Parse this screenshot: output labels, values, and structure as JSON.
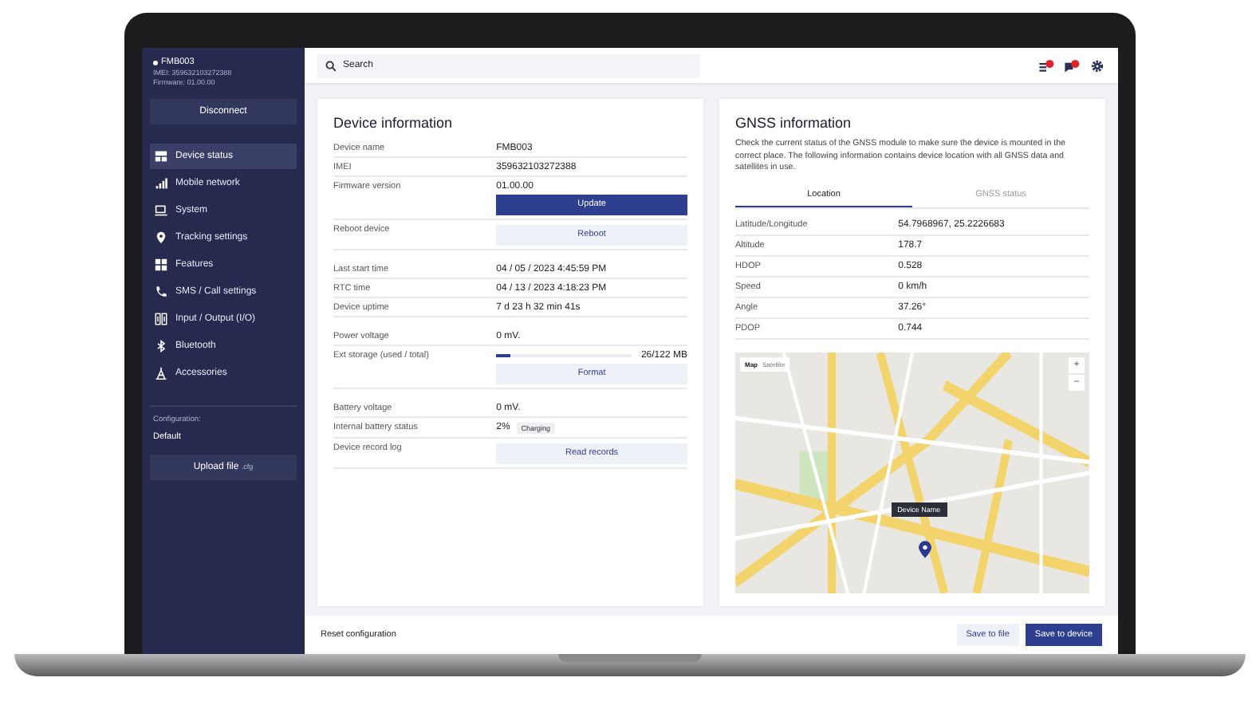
{
  "sidebar": {
    "device": {
      "name": "FMB003",
      "imei": "IMEI: 359632103272388",
      "firmware": "Firmware: 01.00.00"
    },
    "disconnect": "Disconnect",
    "items": [
      {
        "label": "Device status",
        "selected": true
      },
      {
        "label": "Mobile network",
        "selected": false
      },
      {
        "label": "System",
        "selected": false
      },
      {
        "label": "Tracking settings",
        "selected": false
      },
      {
        "label": "Features",
        "selected": false
      },
      {
        "label": "SMS / Call settings",
        "selected": false
      },
      {
        "label": "Input / Output (I/O)",
        "selected": false
      },
      {
        "label": "Bluetooth",
        "selected": false
      },
      {
        "label": "Accessories",
        "selected": false
      }
    ],
    "configuration_label": "Configuration:",
    "configuration_value": "Default",
    "upload": {
      "label": "Upload file",
      "hint": ".cfg"
    }
  },
  "search": {
    "placeholder": "Search"
  },
  "device_info": {
    "title": "Device information",
    "groups": [
      [
        {
          "kind": "text",
          "label": "Device name",
          "value": "FMB003"
        },
        {
          "kind": "text",
          "label": "IMEI",
          "value": "359632103272388"
        },
        {
          "kind": "button",
          "label": "Firmware version",
          "value": "01.00.00",
          "button": {
            "label": "Update",
            "kind": "primary"
          }
        },
        {
          "kind": "button",
          "label": "Reboot device",
          "button": {
            "label": "Reboot",
            "kind": "secondary"
          }
        }
      ],
      [
        {
          "kind": "text",
          "label": "Last start time",
          "value": "04 / 05 / 2023  4:45:59 PM"
        },
        {
          "kind": "text",
          "label": "RTC time",
          "value": "04 / 13 / 2023  4:18:23 PM"
        },
        {
          "kind": "text",
          "label": "Device uptime",
          "value": "7 d 23 h 32 min 41s"
        }
      ],
      [
        {
          "kind": "text",
          "label": "Power voltage",
          "value": "0 mV."
        },
        {
          "kind": "progress",
          "label": "Ext storage (used / total)",
          "level": 0.1,
          "reading": "26/122 MB",
          "button": {
            "label": "Format",
            "kind": "secondary"
          }
        }
      ],
      [
        {
          "kind": "text",
          "label": "Battery voltage",
          "value": "0 mV."
        },
        {
          "kind": "badge",
          "label": "Internal battery status",
          "value": "2%",
          "badge": "Charging"
        },
        {
          "kind": "button",
          "label": "Device record log",
          "button": {
            "label": "Read records",
            "kind": "secondary"
          }
        }
      ]
    ]
  },
  "gnss": {
    "title": "GNSS information",
    "description": "Check the current status of the GNSS module to make sure the device is mounted in the correct place. The following information contains device location with all GNSS data and satellites in use.",
    "tabs": [
      {
        "label": "Location",
        "selected": true
      },
      {
        "label": "GNSS status",
        "selected": false
      }
    ],
    "rows": [
      {
        "label": "Latitude/Longitude",
        "value": "54.7968967, 25.2226683"
      },
      {
        "label": "Altitude",
        "value": "178.7"
      },
      {
        "label": "HDOP",
        "value": "0.528"
      },
      {
        "label": "Speed",
        "value": "0 km/h"
      },
      {
        "label": "Angle",
        "value": "37.26°"
      },
      {
        "label": "PDOP",
        "value": "0.744"
      }
    ],
    "map": {
      "types": [
        {
          "label": "Map",
          "selected": true
        },
        {
          "label": "Satellite",
          "selected": false
        }
      ],
      "zoom_in": "+",
      "zoom_out": "−",
      "tooltip": "Device Name"
    }
  },
  "footer": {
    "reset": "Reset configuration",
    "buttons": [
      {
        "label": "Save to file",
        "kind": "secondary"
      },
      {
        "label": "Save to device",
        "kind": "primary"
      }
    ]
  }
}
